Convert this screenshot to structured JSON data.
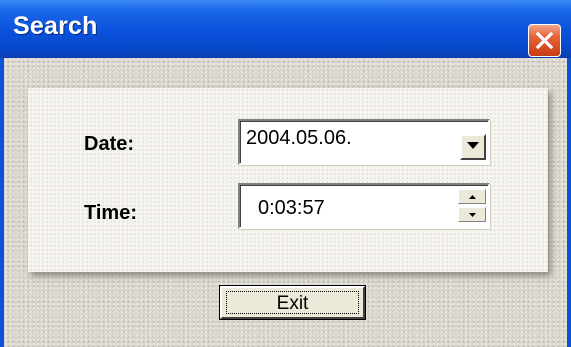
{
  "window": {
    "title": "Search"
  },
  "icons": {
    "close": "close-icon",
    "dropdown": "chevron-down-icon",
    "spin_up": "spin-up-icon",
    "spin_down": "spin-down-icon"
  },
  "colors": {
    "titlebar": "#0a52dc",
    "close_button": "#d64a20",
    "panel": "#f4f3ee",
    "client": "#d9d6cd"
  },
  "form": {
    "date_label": "Date:",
    "date_value": "2004.05.06.",
    "time_label": "Time:",
    "time_value": "0:03:57"
  },
  "buttons": {
    "exit_label": "Exit"
  }
}
